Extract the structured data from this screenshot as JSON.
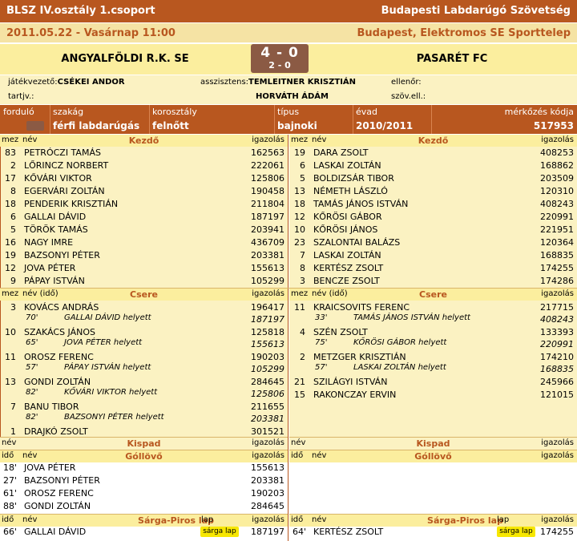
{
  "header": {
    "competition": "BLSZ IV.osztály 1.csoport",
    "federation": "Budapesti Labdarúgó Szövetség",
    "datetime": "2011.05.22 - Vasárnap 11:00",
    "venue": "Budapest, Elektromos SE Sporttelep"
  },
  "match": {
    "home": "ANGYALFÖLDI R.K. SE",
    "away": "PASARÉT FC",
    "score": "4 - 0",
    "halftime": "2 - 0"
  },
  "officials": {
    "referee_label": "játékvezető:",
    "referee": "CSÉKEI ANDOR",
    "assistants_label": "asszisztens:",
    "assistant1": "TEMLEITNER KRISZTIÁN",
    "assistant2": "HORVÁTH ÁDÁM",
    "controller_label": "ellenőr:",
    "reserve_label": "tartjv.:",
    "observer_label": "szöv.ell.:"
  },
  "info": {
    "round_label": "forduló",
    "discipline_label": "szakág",
    "discipline": "férfi labdarúgás",
    "age_label": "korosztály",
    "age": "felnőtt",
    "type_label": "típus",
    "type": "bajnoki",
    "season_label": "évad",
    "season": "2010/2011",
    "code_label": "mérkőzés kódja",
    "code": "517953"
  },
  "labels": {
    "mez": "mez",
    "nev": "név",
    "nev_ido": "név (idő)",
    "igazolas": "igazolás",
    "kezdo": "Kezdő",
    "csere": "Csere",
    "kispad": "Kispad",
    "gollovo": "Góllövő",
    "ido": "idő",
    "sarga_piros": "Sárga-Piros lap",
    "lap": "lap"
  },
  "home_starters": [
    {
      "num": "83",
      "name": "PETRÓCZI TAMÁS",
      "lic": "162563"
    },
    {
      "num": "2",
      "name": "LŐRINCZ NORBERT",
      "lic": "222061"
    },
    {
      "num": "17",
      "name": "KŐVÁRI VIKTOR",
      "lic": "125806"
    },
    {
      "num": "8",
      "name": "EGERVÁRI ZOLTÁN",
      "lic": "190458"
    },
    {
      "num": "18",
      "name": "PENDERIK KRISZTIÁN",
      "lic": "211804"
    },
    {
      "num": "6",
      "name": "GALLAI DÁVID",
      "lic": "187197"
    },
    {
      "num": "5",
      "name": "TÖRÖK TAMÁS",
      "lic": "203941"
    },
    {
      "num": "16",
      "name": "NAGY IMRE",
      "lic": "436709"
    },
    {
      "num": "19",
      "name": "BAZSONYI PÉTER",
      "lic": "203381"
    },
    {
      "num": "12",
      "name": "JOVA PÉTER",
      "lic": "155613"
    },
    {
      "num": "9",
      "name": "PÁPAY ISTVÁN",
      "lic": "105299"
    }
  ],
  "away_starters": [
    {
      "num": "19",
      "name": "DARA ZSOLT",
      "lic": "408253"
    },
    {
      "num": "6",
      "name": "LASKAI ZOLTÁN",
      "lic": "168862"
    },
    {
      "num": "5",
      "name": "BOLDIZSÁR TIBOR",
      "lic": "203509"
    },
    {
      "num": "13",
      "name": "NÉMETH LÁSZLÓ",
      "lic": "120310"
    },
    {
      "num": "18",
      "name": "TAMÁS JÁNOS ISTVÁN",
      "lic": "408243"
    },
    {
      "num": "12",
      "name": "KŐRÖSI GÁBOR",
      "lic": "220991"
    },
    {
      "num": "10",
      "name": "KŐRÖSI JÁNOS",
      "lic": "221951"
    },
    {
      "num": "23",
      "name": "SZALONTAI BALÁZS",
      "lic": "120364"
    },
    {
      "num": "7",
      "name": "LASKAI ZOLTÁN",
      "lic": "168835"
    },
    {
      "num": "8",
      "name": "KERTÉSZ ZSOLT",
      "lic": "174255"
    },
    {
      "num": "3",
      "name": "BENCZE ZSOLT",
      "lic": "174286"
    }
  ],
  "home_subs": [
    {
      "num": "3",
      "name": "KOVÁCS ANDRÁS",
      "lic": "196417",
      "time": "70'",
      "detail": "GALLAI DÁVID helyett",
      "dlic": "187197"
    },
    {
      "num": "10",
      "name": "SZAKÁCS JÁNOS",
      "lic": "125818",
      "time": "65'",
      "detail": "JOVA PÉTER helyett",
      "dlic": "155613"
    },
    {
      "num": "11",
      "name": "OROSZ FERENC",
      "lic": "190203",
      "time": "57'",
      "detail": "PÁPAY ISTVÁN helyett",
      "dlic": "105299"
    },
    {
      "num": "13",
      "name": "GONDI ZOLTÁN",
      "lic": "284645",
      "time": "82'",
      "detail": "KŐVÁRI VIKTOR helyett",
      "dlic": "125806"
    },
    {
      "num": "7",
      "name": "BANU TIBOR",
      "lic": "211655",
      "time": "82'",
      "detail": "BAZSONYI PÉTER helyett",
      "dlic": "203381"
    },
    {
      "num": "1",
      "name": "DRAJKÓ ZSOLT",
      "lic": "301521"
    }
  ],
  "away_subs": [
    {
      "num": "11",
      "name": "KRAICSOVITS FERENC",
      "lic": "217715",
      "time": "33'",
      "detail": "TAMÁS JÁNOS ISTVÁN helyett",
      "dlic": "408243"
    },
    {
      "num": "4",
      "name": "SZÉN ZSOLT",
      "lic": "133393",
      "time": "75'",
      "detail": "KŐRÖSI GÁBOR helyett",
      "dlic": "220991"
    },
    {
      "num": "2",
      "name": "METZGER KRISZTIÁN",
      "lic": "174210",
      "time": "57'",
      "detail": "LASKAI ZOLTÁN helyett",
      "dlic": "168835"
    },
    {
      "num": "21",
      "name": "SZILÁGYI ISTVÁN",
      "lic": "245966"
    },
    {
      "num": "15",
      "name": "RAKONCZAY ERVIN",
      "lic": "121015"
    }
  ],
  "home_goals": [
    {
      "time": "18'",
      "name": "JOVA PÉTER",
      "lic": "155613"
    },
    {
      "time": "27'",
      "name": "BAZSONYI PÉTER",
      "lic": "203381"
    },
    {
      "time": "61'",
      "name": "OROSZ FERENC",
      "lic": "190203"
    },
    {
      "time": "88'",
      "name": "GONDI ZOLTÁN",
      "lic": "284645"
    }
  ],
  "home_cards": [
    {
      "time": "66'",
      "name": "GALLAI DÁVID",
      "card": "sárga lap",
      "lic": "187197"
    }
  ],
  "away_cards": [
    {
      "time": "64'",
      "name": "KERTÉSZ ZSOLT",
      "card": "sárga lap",
      "lic": "174255"
    }
  ],
  "colors": {
    "header_bg": "#b8571f",
    "date_bg": "#f5e3a4",
    "team_bg": "#fbee9e",
    "panel_bg": "#fbf2c2",
    "score_bg": "#8b5a44",
    "card_yellow": "#f7e700"
  }
}
